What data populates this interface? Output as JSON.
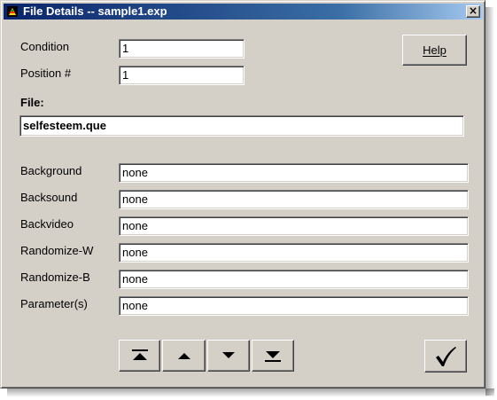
{
  "window": {
    "title": "File Details -- sample1.exp",
    "close_glyph": "×"
  },
  "form": {
    "condition_label": "Condition",
    "condition_value": "1",
    "position_label": "Position #",
    "position_value": "1",
    "file_label": "File:",
    "file_value": "selfesteem.que",
    "background_label": "Background",
    "background_value": "none",
    "backsound_label": "Backsound",
    "backsound_value": "none",
    "backvideo_label": "Backvideo",
    "backvideo_value": "none",
    "randomize_w_label": "Randomize-W",
    "randomize_w_value": "none",
    "randomize_b_label": "Randomize-B",
    "randomize_b_value": "none",
    "parameters_label": "Parameter(s)",
    "parameters_value": "none"
  },
  "buttons": {
    "help_label": "Help",
    "nav": [
      "move-first-icon",
      "move-up-icon",
      "move-down-icon",
      "move-last-icon"
    ],
    "ok_icon": "checkmark-icon"
  },
  "colors": {
    "titlebar_start": "#0a246a",
    "titlebar_end": "#a6caf0",
    "face": "#d4d0c8"
  }
}
